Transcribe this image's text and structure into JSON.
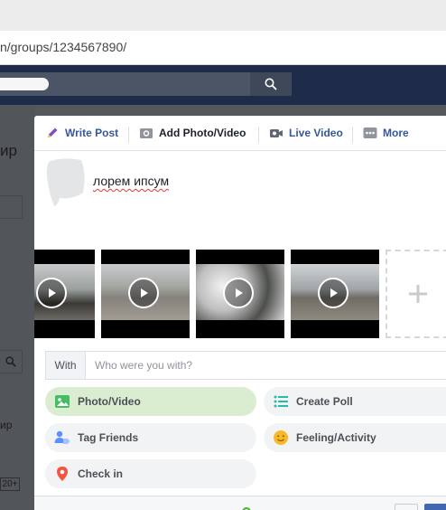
{
  "browser": {
    "url_text": "n/groups/1234567890/"
  },
  "background_page": {
    "heading_fragment": "ир",
    "sidebar_fragment": "ир",
    "count_badge": "20+"
  },
  "composer": {
    "tabs": [
      {
        "label": "Write Post",
        "icon": "pencil-icon"
      },
      {
        "label": "Add Photo/Video",
        "icon": "camera-icon"
      },
      {
        "label": "Live Video",
        "icon": "video-camera-icon"
      },
      {
        "label": "More",
        "icon": "more-dots-icon"
      }
    ],
    "post_text": "лорем ипсум",
    "with": {
      "label": "With",
      "placeholder": "Who were you with?"
    },
    "options": [
      {
        "label": "Photo/Video",
        "icon": "photo-icon",
        "color": "#45bd62",
        "active": true
      },
      {
        "label": "Create Poll",
        "icon": "poll-list-icon",
        "color": "#2abba7",
        "active": false
      },
      {
        "label": "Tag Friends",
        "icon": "tag-friends-icon",
        "color": "#5890ff",
        "active": false
      },
      {
        "label": "Feeling/Activity",
        "icon": "smiley-icon",
        "color": "#f7b928",
        "active": false
      },
      {
        "label": "Check in",
        "icon": "location-pin-icon",
        "color": "#f5533d",
        "active": false
      }
    ]
  },
  "colors": {
    "facebook_header": "#1e2c4a",
    "link_blue": "#365899",
    "primary_button": "#4267b2"
  }
}
